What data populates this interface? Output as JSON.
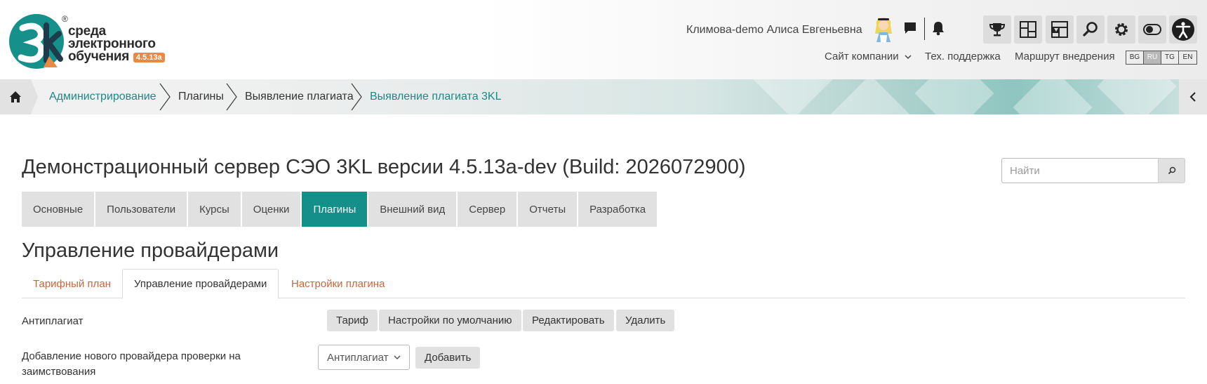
{
  "logo": {
    "line1": "среда",
    "line2": "электронного",
    "line3": "обучения",
    "version": "4.5.13a",
    "registered": "®"
  },
  "header": {
    "user_name": "Климова-demo Алиса Евгеньевна",
    "links": {
      "company_site": "Сайт компании",
      "support": "Тех. поддержка",
      "route": "Маршрут внедрения"
    },
    "languages": [
      "BG",
      "RU",
      "TG",
      "EN"
    ],
    "active_language": "RU"
  },
  "breadcrumb": {
    "items": [
      {
        "label": "Администрирование"
      },
      {
        "label": "Плагины"
      },
      {
        "label": "Выявление плагиата"
      },
      {
        "label": "Выявление плагиата 3KL"
      }
    ]
  },
  "page": {
    "title": "Демонстрационный сервер СЭО 3KL версии 4.5.13a-dev (Build: 2026072900)",
    "search_placeholder": "Найти"
  },
  "admin_tabs": [
    {
      "label": "Основные"
    },
    {
      "label": "Пользователи"
    },
    {
      "label": "Курсы"
    },
    {
      "label": "Оценки"
    },
    {
      "label": "Плагины",
      "active": true
    },
    {
      "label": "Внешний вид"
    },
    {
      "label": "Сервер"
    },
    {
      "label": "Отчеты"
    },
    {
      "label": "Разработка"
    }
  ],
  "section": {
    "title": "Управление провайдерами",
    "tabs": [
      {
        "label": "Тарифный план"
      },
      {
        "label": "Управление провайдерами",
        "active": true
      },
      {
        "label": "Настройки плагина"
      }
    ]
  },
  "provider_row": {
    "label": "Антиплагиат",
    "buttons": {
      "tariff": "Тариф",
      "defaults": "Настройки по умолчанию",
      "edit": "Редактировать",
      "delete": "Удалить"
    }
  },
  "add_row": {
    "label": "Добавление нового провайдера проверки на заимствования",
    "select_value": "Антиплагиат",
    "add_button": "Добавить"
  },
  "colors": {
    "accent": "#158f8a",
    "link": "#1a8a86",
    "subtab_link": "#c8663a",
    "version_badge": "#e88a46"
  },
  "icons": {
    "avatar": "alice-avatar",
    "messages": "chat-bubble-icon",
    "notifications": "bell-icon",
    "tools": [
      "trophy-icon",
      "dashboard-icon",
      "layout-icon",
      "search-icon",
      "gear-icon",
      "toggle-icon",
      "accessibility-icon"
    ],
    "home": "home-icon",
    "collapse": "chevron-left-icon"
  }
}
